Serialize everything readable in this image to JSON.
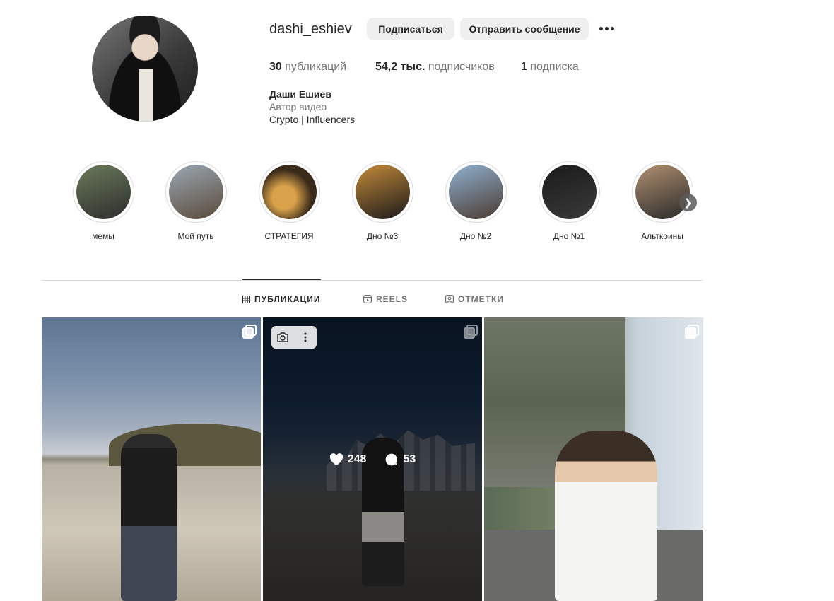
{
  "profile": {
    "username": "dashi_eshiev",
    "follow_label": "Подписаться",
    "message_label": "Отправить сообщение",
    "posts_count": "30",
    "posts_word": "публикаций",
    "followers_count": "54,2 тыс.",
    "followers_word": "подписчиков",
    "following_count": "1",
    "following_word": "подписка",
    "name": "Даши Ешиев",
    "category": "Автор видео",
    "bio": "Crypto | Influencers"
  },
  "highlights": [
    {
      "label": "мемы",
      "colors": [
        "#6b7a5a",
        "#2d2d2d"
      ]
    },
    {
      "label": "Мой путь",
      "colors": [
        "#9aa7b3",
        "#5a4a3a"
      ]
    },
    {
      "label": "СТРАТЕГИЯ",
      "colors": [
        "#d9a24a",
        "#3a2a1a"
      ]
    },
    {
      "label": "Дно №3",
      "colors": [
        "#c48a3a",
        "#1a1a1a"
      ]
    },
    {
      "label": "Дно №2",
      "colors": [
        "#8fb0d0",
        "#4a3a30"
      ]
    },
    {
      "label": "Дно №1",
      "colors": [
        "#1a1a1a",
        "#3a3a3a"
      ]
    },
    {
      "label": "Альткоины",
      "colors": [
        "#b09070",
        "#2a2a2a"
      ]
    }
  ],
  "tabs": {
    "posts": "ПУБЛИКАЦИИ",
    "reels": "REELS",
    "tagged": "ОТМЕТКИ"
  },
  "posts": [
    {
      "type": "carousel"
    },
    {
      "type": "carousel",
      "likes": "248",
      "comments": "53"
    },
    {
      "type": "carousel"
    }
  ],
  "icons": {
    "more": "more-horizontal-icon",
    "next": "chevron-right-icon",
    "grid": "grid-icon",
    "reels": "reels-icon",
    "tagged": "tagged-icon",
    "heart": "heart-icon",
    "comment": "comment-icon",
    "camera": "camera-search-icon",
    "kebab": "more-vertical-icon",
    "carousel": "carousel-icon"
  }
}
